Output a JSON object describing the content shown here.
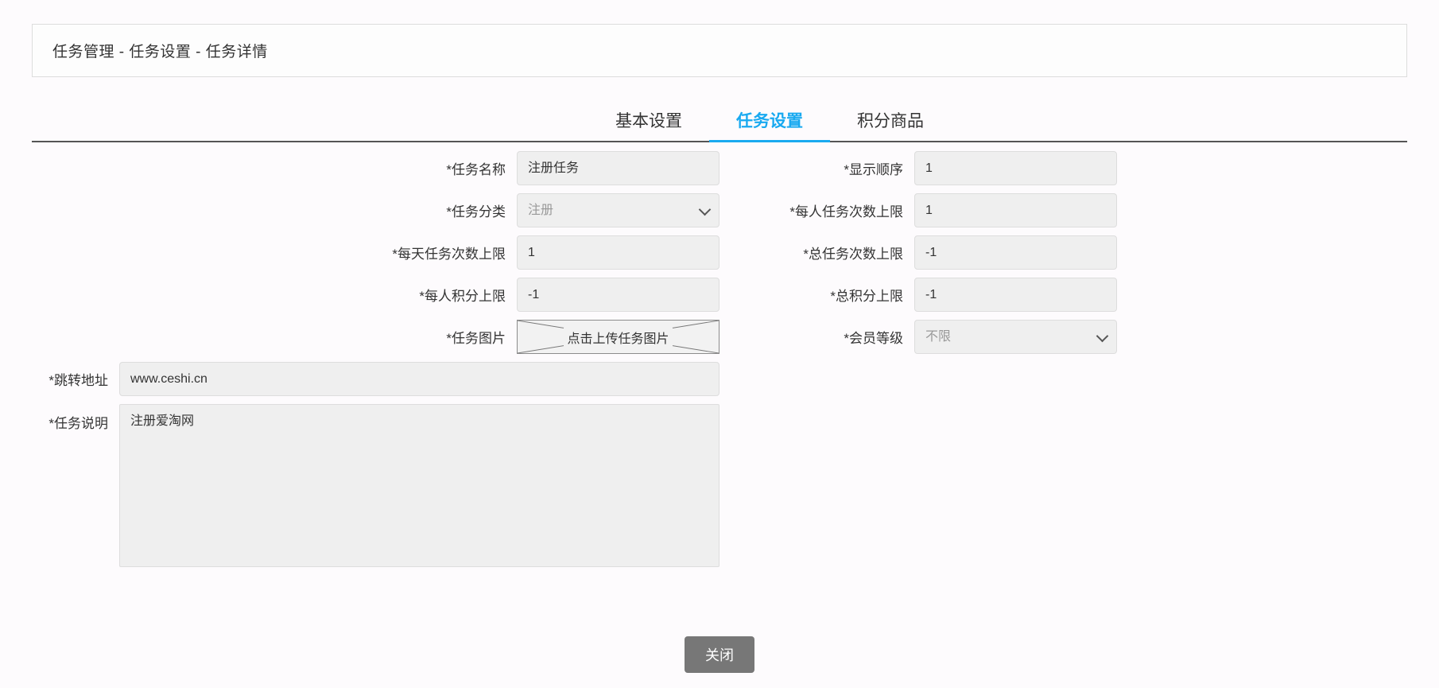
{
  "breadcrumb": {
    "text": "任务管理 - 任务设置 - 任务详情"
  },
  "tabs": [
    {
      "label": "基本设置",
      "active": false
    },
    {
      "label": "任务设置",
      "active": true
    },
    {
      "label": "积分商品",
      "active": false
    }
  ],
  "colors": {
    "active_tab": "#1aaaf0",
    "field_bg": "#efefef",
    "button_bg": "#777777"
  },
  "form": {
    "task_name": {
      "label": "*任务名称",
      "value": "注册任务"
    },
    "display_order": {
      "label": "*显示顺序",
      "value": "1"
    },
    "task_category": {
      "label": "*任务分类",
      "value": "注册",
      "icon": "chevron-down-icon"
    },
    "per_person_task_limit": {
      "label": "*每人任务次数上限",
      "value": "1"
    },
    "per_day_task_limit": {
      "label": "*每天任务次数上限",
      "value": "1"
    },
    "total_task_limit": {
      "label": "*总任务次数上限",
      "value": "-1"
    },
    "per_person_point_limit": {
      "label": "*每人积分上限",
      "value": "-1"
    },
    "total_point_limit": {
      "label": "*总积分上限",
      "value": "-1"
    },
    "task_image": {
      "label": "*任务图片",
      "alt_text": "点击上传任务图片",
      "icon": "broken-image-icon"
    },
    "member_level": {
      "label": "*会员等级",
      "value": "不限",
      "icon": "chevron-down-icon"
    },
    "jump_url": {
      "label": "*跳转地址",
      "value": "www.ceshi.cn"
    },
    "task_description": {
      "label": "*任务说明",
      "value": "注册爱淘网"
    }
  },
  "footer": {
    "close_label": "关闭"
  }
}
